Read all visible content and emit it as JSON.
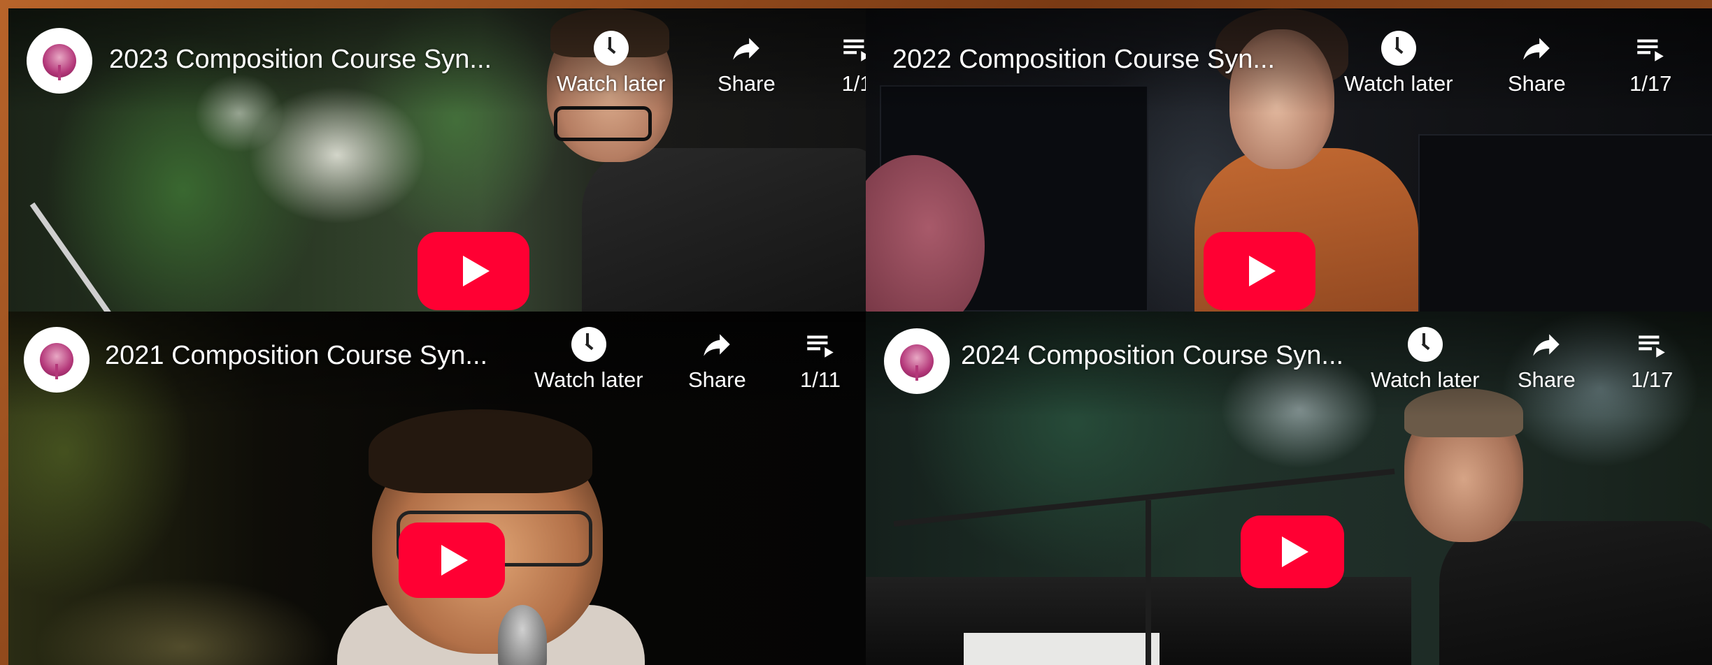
{
  "videos": [
    {
      "title": "2023 Composition Course Syn...",
      "watch_later": "Watch later",
      "share": "Share",
      "playlist": "1/1"
    },
    {
      "title": "2022 Composition Course Syn...",
      "watch_later": "Watch later",
      "share": "Share",
      "playlist": "1/17"
    },
    {
      "title": "2021 Composition Course Syn...",
      "watch_later": "Watch later",
      "share": "Share",
      "playlist": "1/11"
    },
    {
      "title": "2024 Composition Course Syn...",
      "watch_later": "Watch later",
      "share": "Share",
      "playlist": "1/17"
    }
  ],
  "colors": {
    "play_button": "#ff0033",
    "channel_accent": "#b4387a",
    "frame": "#9c5424"
  },
  "icons": {
    "watch_later": "clock-icon",
    "share": "share-arrow-icon",
    "playlist": "playlist-icon",
    "play": "play-icon"
  }
}
